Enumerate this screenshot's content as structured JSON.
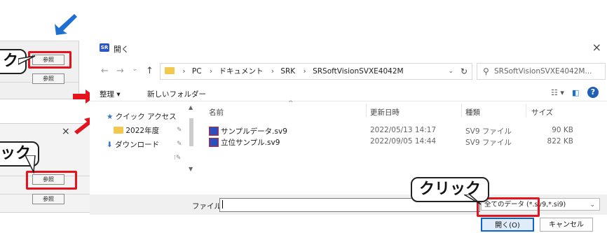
{
  "left_panels": {
    "top_button_1": "参照",
    "top_button_2": "参照",
    "bottom_button_1": "参照",
    "bottom_button_2": "参照",
    "close_glyph": "×"
  },
  "callouts": {
    "top": "ク",
    "middle": "ック",
    "bottom": "クリック"
  },
  "dialog": {
    "title": "開く",
    "app_icon_text": "SR",
    "close_glyph": "×",
    "nav": {
      "back": "←",
      "forward": "→",
      "recent": "⌄",
      "up": "↑"
    },
    "breadcrumb": [
      "PC",
      "ドキュメント",
      "SRK",
      "SRSoftVisionSVXE4042M"
    ],
    "breadcrumb_sep": "›",
    "refresh": "↻",
    "search_placeholder": "SRSoftVisionSVXE4042M...",
    "toolbar": {
      "organize": "整理 ▾",
      "new_folder": "新しいフォルダー",
      "help": "?"
    },
    "nav_pane": [
      {
        "label": "クイック アクセス"
      },
      {
        "label": "2022年度"
      },
      {
        "label": "ダウンロード"
      }
    ],
    "columns": {
      "name": "名前",
      "modified": "更新日時",
      "type": "種類",
      "size": "サイズ"
    },
    "files": [
      {
        "name": "サンプルデータ.sv9",
        "modified": "2022/05/13 14:17",
        "type": "SV9 ファイル",
        "size": "90 KB"
      },
      {
        "name": "立位サンプル.sv9",
        "modified": "2022/09/05 14:44",
        "type": "SV9 ファイル",
        "size": "822 KB"
      }
    ],
    "filename_label": "ファイル名(N):",
    "filename_value": "",
    "filter_value": "全てのデータ (*.sv9,*.si9)",
    "open_button": "開く(O)",
    "cancel_button": "キャンセル"
  },
  "colors": {
    "accent_red": "#e3141e",
    "arrow_red": "#e3141e",
    "arrow_blue": "#1f6fd1",
    "open_button_border": "#0a64d6"
  }
}
